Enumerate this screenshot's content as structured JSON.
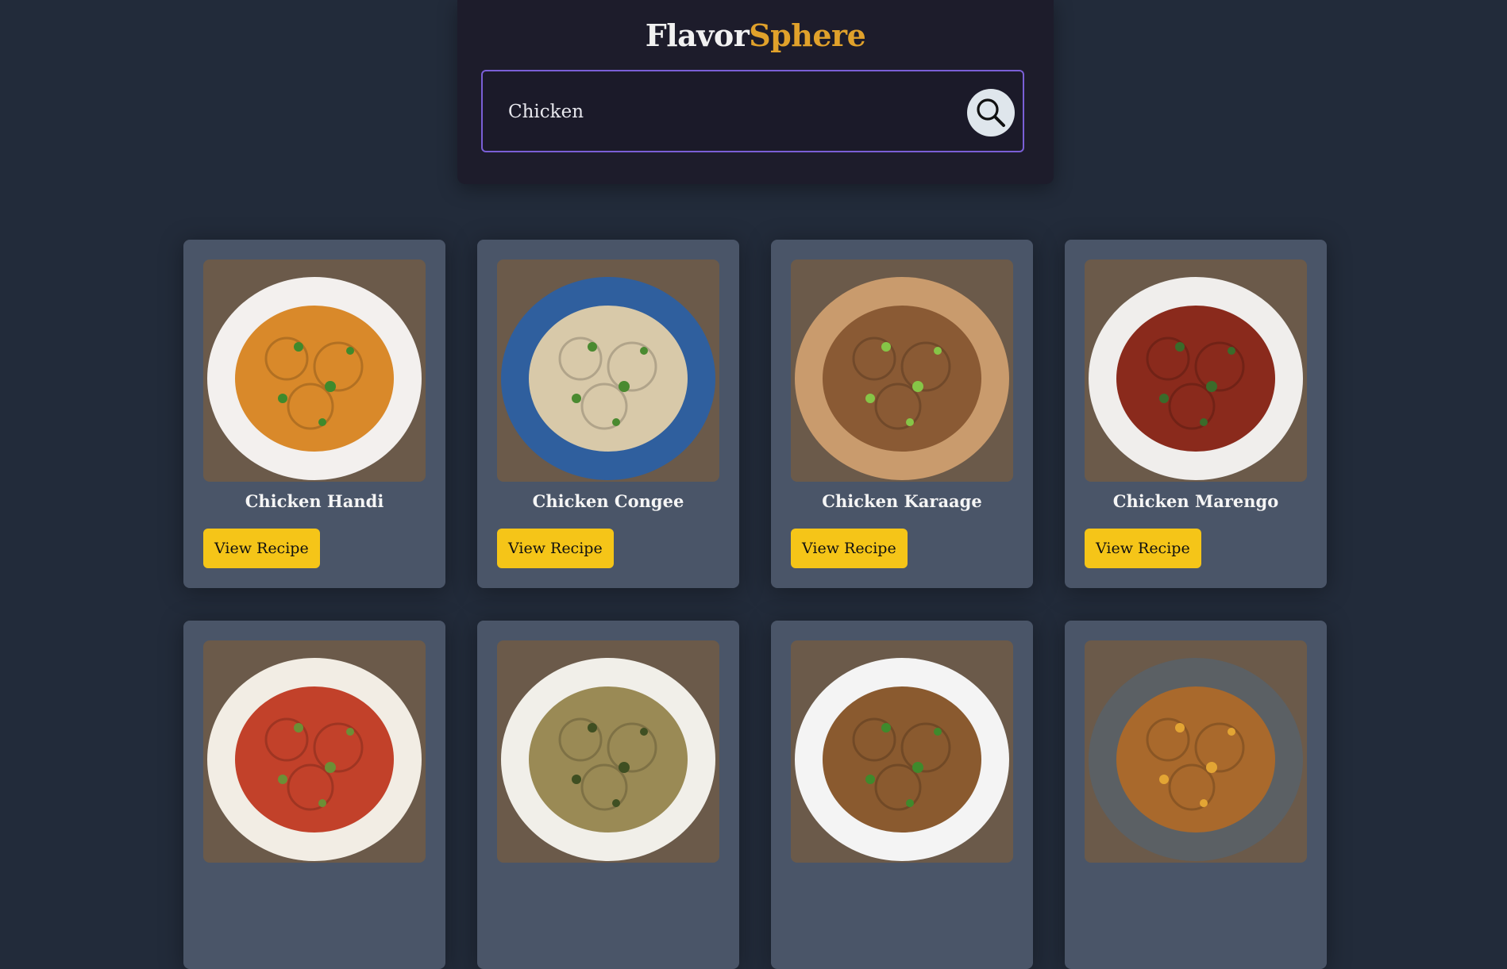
{
  "brand": {
    "part1": "Flavor",
    "part2": "Sphere"
  },
  "search": {
    "value": "Chicken",
    "icon": "search-icon"
  },
  "cards": [
    {
      "title": "Chicken Handi",
      "button": "View Recipe",
      "plate": "#f3f0ee",
      "food": "#d9892a",
      "accent": "#3f8a2c"
    },
    {
      "title": "Chicken Congee",
      "button": "View Recipe",
      "plate": "#2f5f9e",
      "food": "#d8c9a9",
      "accent": "#4a8a30"
    },
    {
      "title": "Chicken Karaage",
      "button": "View Recipe",
      "plate": "#c99b6d",
      "food": "#8a5a34",
      "accent": "#86c547"
    },
    {
      "title": "Chicken Marengo",
      "button": "View Recipe",
      "plate": "#f0eeec",
      "food": "#8a2a1c",
      "accent": "#3a6b2a"
    },
    {
      "title": "",
      "button": "",
      "plate": "#f2ede4",
      "food": "#c2412a",
      "accent": "#6c8f36"
    },
    {
      "title": "",
      "button": "",
      "plate": "#f1efe9",
      "food": "#9a8a55",
      "accent": "#3f4f22"
    },
    {
      "title": "",
      "button": "",
      "plate": "#f4f4f4",
      "food": "#8a5a2f",
      "accent": "#3f8a2c"
    },
    {
      "title": "",
      "button": "",
      "plate": "#5b6064",
      "food": "#a9692c",
      "accent": "#e3a534"
    }
  ]
}
